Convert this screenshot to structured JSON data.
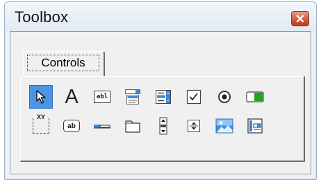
{
  "window": {
    "title": "Toolbox"
  },
  "tabs": [
    {
      "label": "Controls"
    }
  ],
  "tools": {
    "row1": [
      {
        "icon": "select-objects-icon",
        "selected": true
      },
      {
        "icon": "label-icon",
        "glyph": "A"
      },
      {
        "icon": "textbox-icon",
        "glyph": "abl"
      },
      {
        "icon": "combobox-icon"
      },
      {
        "icon": "listbox-icon"
      },
      {
        "icon": "checkbox-icon"
      },
      {
        "icon": "option-button-icon"
      },
      {
        "icon": "toggle-button-icon"
      }
    ],
    "row2": [
      {
        "icon": "frame-icon",
        "glyph": "XY"
      },
      {
        "icon": "command-button-icon",
        "glyph": "ab"
      },
      {
        "icon": "tabstrip-icon"
      },
      {
        "icon": "multipage-icon"
      },
      {
        "icon": "scrollbar-icon"
      },
      {
        "icon": "spinbutton-icon"
      },
      {
        "icon": "image-icon"
      },
      {
        "icon": "refedit-icon"
      }
    ]
  },
  "colors": {
    "selected": "#4a95e6",
    "close": "#d35a41",
    "accent_green": "#22a622"
  }
}
